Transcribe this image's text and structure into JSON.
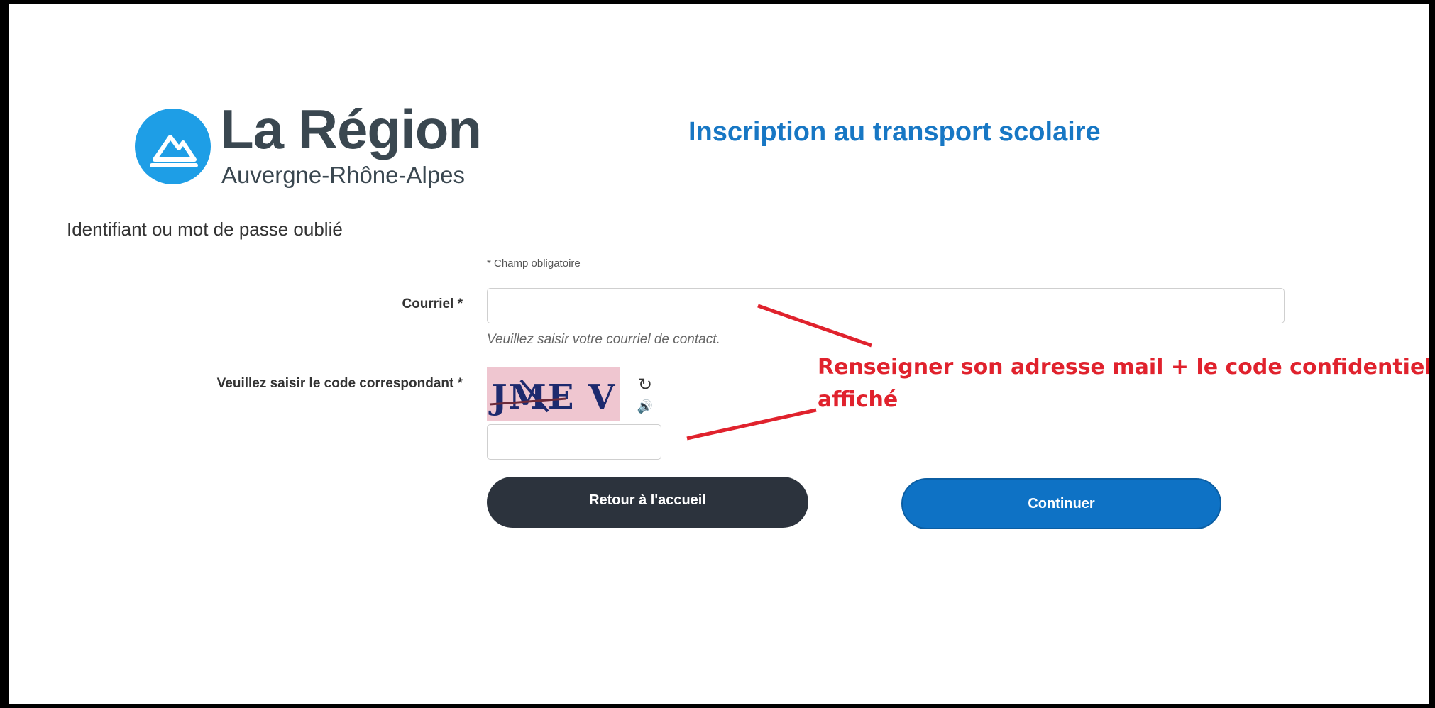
{
  "logo": {
    "title": "La Région",
    "subtitle": "Auvergne-Rhône-Alpes",
    "icon": "mountain-logo-icon",
    "color": "#1e9ee6"
  },
  "header": {
    "title": "Inscription au transport scolaire",
    "title_color": "#1777c4"
  },
  "form": {
    "section_title": "Identifiant ou mot de passe oublié",
    "required_note": "* Champ obligatoire",
    "email_label": "Courriel *",
    "email_value": "",
    "email_help": "Veuillez saisir votre courriel de contact.",
    "captcha_label": "Veuillez saisir le code correspondant *",
    "captcha_text": "JME V",
    "captcha_value": "",
    "refresh_icon": "refresh-icon",
    "audio_icon": "speaker-icon"
  },
  "buttons": {
    "back_label": "Retour à l'accueil",
    "continue_label": "Continuer",
    "back_color": "#2c333d",
    "continue_color": "#0e72c5"
  },
  "annotation": {
    "line1": "Renseigner son adresse mail + le code confidentiel",
    "line2": "affiché",
    "color": "#e0222d"
  }
}
